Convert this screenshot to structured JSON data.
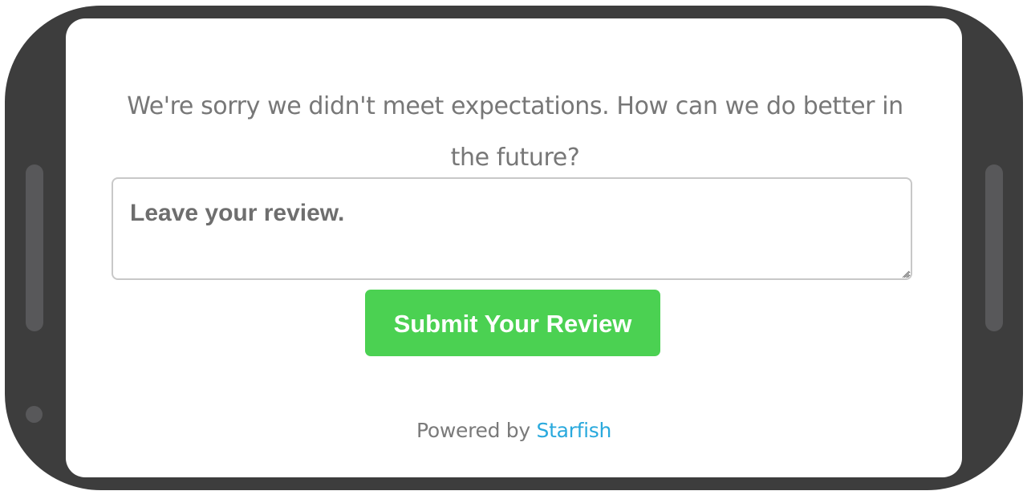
{
  "feedback": {
    "question": "We're sorry we didn't meet expectations. How can we do better in the future?",
    "review_placeholder": "Leave your review.",
    "review_value": "",
    "submit_label": "Submit Your Review"
  },
  "footer": {
    "powered_by_text": "Powered by",
    "brand_link": "Starfish"
  },
  "colors": {
    "device_frame": "#3d3d3d",
    "submit_button": "#4bd152",
    "link": "#29a9dd",
    "text": "#777777"
  }
}
